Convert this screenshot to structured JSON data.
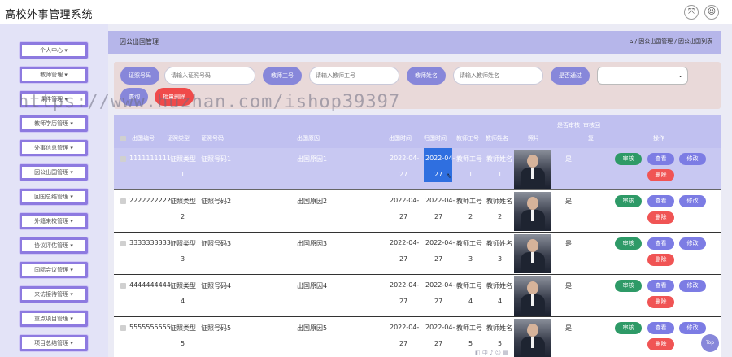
{
  "app": {
    "title": "高校外事管理系统"
  },
  "topbar": {
    "icons": [
      "expand-icon",
      "user-icon"
    ]
  },
  "sidebar": {
    "items": [
      {
        "label": "个人中心"
      },
      {
        "label": "教师管理"
      },
      {
        "label": "课件管理"
      },
      {
        "label": "教师学历管理"
      },
      {
        "label": "外事信息管理"
      },
      {
        "label": "因公出国管理"
      },
      {
        "label": "回国总结管理"
      },
      {
        "label": "外籍来校管理"
      },
      {
        "label": "协议评估管理"
      },
      {
        "label": "国际会议管理"
      },
      {
        "label": "来访接待管理"
      },
      {
        "label": "重点项目管理"
      },
      {
        "label": "项目总结管理"
      }
    ],
    "arrow": "▾"
  },
  "breadcrumb": {
    "title": "因公出国管理",
    "path": "⌂ / 因公出国管理 / 因公出国列表"
  },
  "search": {
    "fields": [
      {
        "label": "证照号码",
        "placeholder": "请输入证照号码"
      },
      {
        "label": "教师工号",
        "placeholder": "请输入教师工号"
      },
      {
        "label": "教师姓名",
        "placeholder": "请输入教师姓名"
      }
    ],
    "status_label": "是否通过",
    "query_button": "查询",
    "batch_delete_button": "批量删除"
  },
  "table": {
    "group_header": "是否审核",
    "group_header2": "审核回",
    "headers": [
      "出国编号",
      "证照类型",
      "证照号码",
      "出国原因",
      "出国时间",
      "归国时间",
      "教师工号",
      "教师姓名",
      "照片",
      "",
      "复",
      "操作"
    ],
    "rows": [
      {
        "code": "1111111111",
        "type1": "证照类型",
        "type2": "1",
        "number": "证照号码1",
        "reason": "出国原因1",
        "out1": "2022-04-",
        "out2": "27",
        "back1": "2022-04-",
        "back2": "27",
        "tno1": "教师工号",
        "tno2": "1",
        "tname1": "教师姓名",
        "tname2": "1",
        "audited": "是"
      },
      {
        "code": "2222222222",
        "type1": "证照类型",
        "type2": "2",
        "number": "证照号码2",
        "reason": "出国原因2",
        "out1": "2022-04-",
        "out2": "27",
        "back1": "2022-04-",
        "back2": "27",
        "tno1": "教师工号",
        "tno2": "2",
        "tname1": "教师姓名",
        "tname2": "2",
        "audited": "是"
      },
      {
        "code": "3333333333",
        "type1": "证照类型",
        "type2": "3",
        "number": "证照号码3",
        "reason": "出国原因3",
        "out1": "2022-04-",
        "out2": "27",
        "back1": "2022-04-",
        "back2": "27",
        "tno1": "教师工号",
        "tno2": "3",
        "tname1": "教师姓名",
        "tname2": "3",
        "audited": "是"
      },
      {
        "code": "4444444444",
        "type1": "证照类型",
        "type2": "4",
        "number": "证照号码4",
        "reason": "出国原因4",
        "out1": "2022-04-",
        "out2": "27",
        "back1": "2022-04-",
        "back2": "27",
        "tno1": "教师工号",
        "tno2": "4",
        "tname1": "教师姓名",
        "tname2": "4",
        "audited": "是"
      },
      {
        "code": "5555555555",
        "type1": "证照类型",
        "type2": "5",
        "number": "证照号码5",
        "reason": "出国原因5",
        "out1": "2022-04-",
        "out2": "27",
        "back1": "2022-04-",
        "back2": "27",
        "tno1": "教师工号",
        "tno2": "5",
        "tname1": "教师姓名",
        "tname2": "5",
        "audited": "是"
      }
    ],
    "actions": {
      "audit": "审核",
      "view": "查看",
      "edit": "修改",
      "delete": "删除"
    }
  },
  "watermark": "https://www.huzhan.com/ishop39397",
  "back_to_top": "Top",
  "pager_text": "◧ 中 ♪ ☺ ▦"
}
